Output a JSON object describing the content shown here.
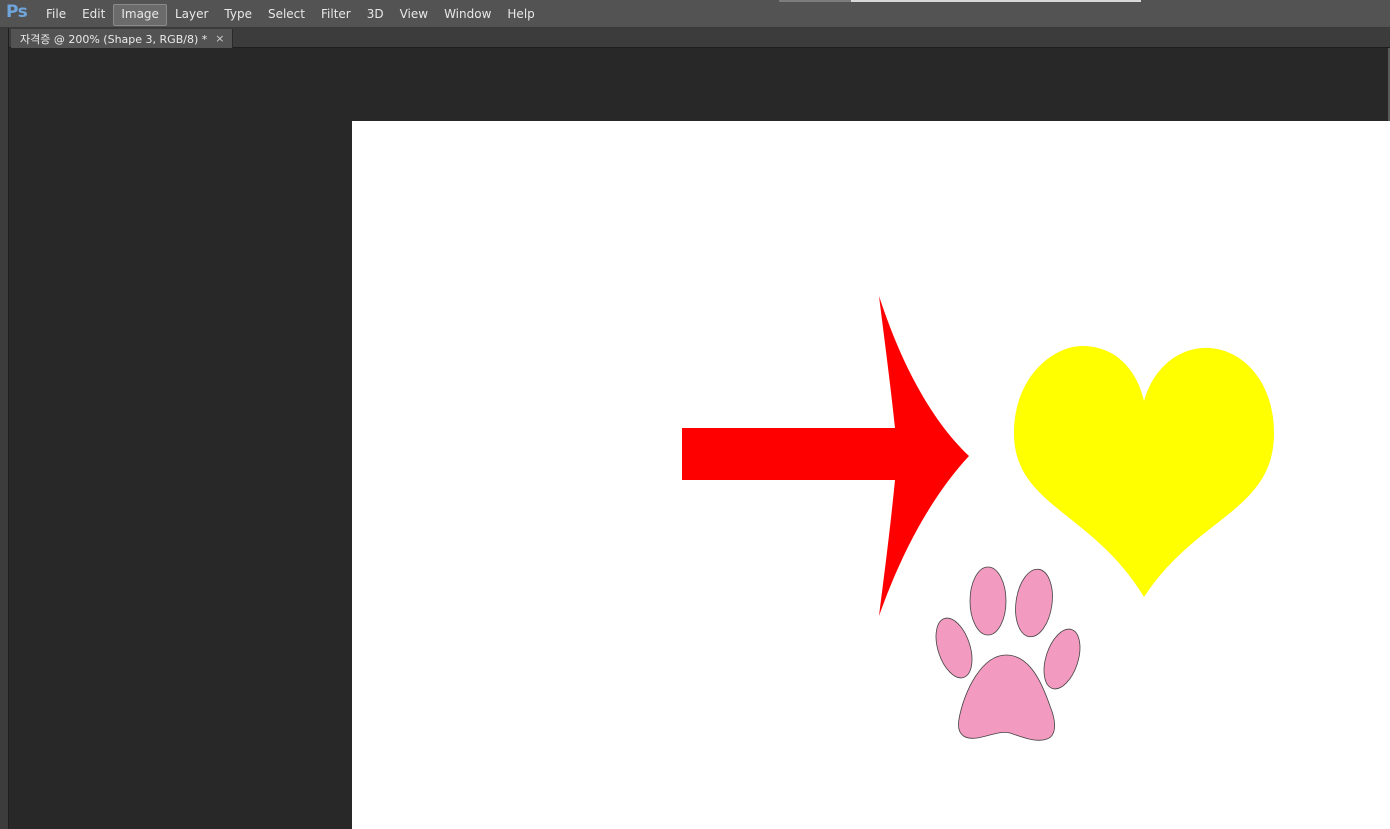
{
  "app": {
    "logo": "Ps",
    "logo_color": "#6fa5dc"
  },
  "menu": {
    "items": [
      "File",
      "Edit",
      "Image",
      "Layer",
      "Type",
      "Select",
      "Filter",
      "3D",
      "View",
      "Window",
      "Help"
    ],
    "active": "Image"
  },
  "document": {
    "tab_title": "자격증 @ 200% (Shape 3, RGB/8) *",
    "close_symbol": "×"
  },
  "canvas": {
    "background": "#ffffff",
    "shapes": [
      {
        "name": "arrow",
        "color": "#ff0000"
      },
      {
        "name": "heart",
        "color": "#ffff00"
      },
      {
        "name": "paw",
        "color": "#f29ac0"
      }
    ]
  }
}
